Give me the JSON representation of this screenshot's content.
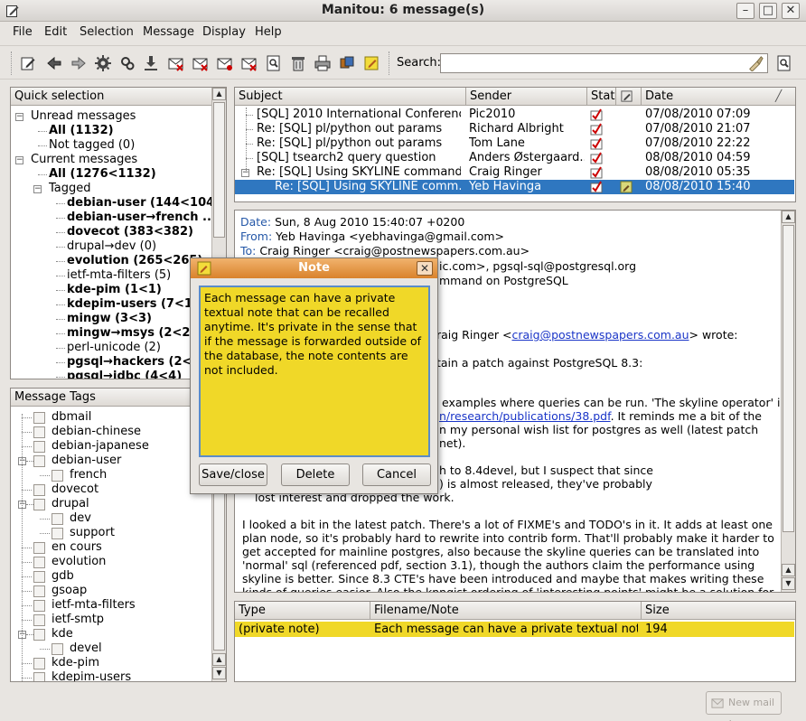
{
  "window": {
    "title": "Manitou: 6 message(s)",
    "min_glyph": "–",
    "max_glyph": "□",
    "close_glyph": "✕"
  },
  "menu": [
    "File",
    "Edit",
    "Selection",
    "Message",
    "Display",
    "Help"
  ],
  "toolbar": {
    "icons": [
      "compose-icon",
      "back-icon",
      "forward-icon",
      "settings-icon",
      "refresh-icon",
      "download-icon",
      "mark-read-icon",
      "mark-unread-icon",
      "mark-archived-icon",
      "mark-deleted-icon",
      "find-icon",
      "trash-icon",
      "print-icon",
      "tags-icon",
      "note-icon"
    ],
    "search_label": "Search:",
    "search_value": ""
  },
  "quick_selection": {
    "header": "Quick selection",
    "items": [
      {
        "label": "Unread messages",
        "bold": false,
        "level": 0,
        "expander": "-"
      },
      {
        "label": "All (1132)",
        "bold": true,
        "level": 1
      },
      {
        "label": "Not tagged (0)",
        "bold": false,
        "level": 1
      },
      {
        "label": "Current messages",
        "bold": false,
        "level": 0,
        "expander": "-"
      },
      {
        "label": "All (1276<1132)",
        "bold": true,
        "level": 1
      },
      {
        "label": "Tagged",
        "bold": false,
        "level": 1,
        "expander": "-"
      },
      {
        "label": "debian-user (144<104)",
        "bold": true,
        "level": 2
      },
      {
        "label": "debian-user→french ...",
        "bold": true,
        "level": 2
      },
      {
        "label": "dovecot (383<382)",
        "bold": true,
        "level": 2
      },
      {
        "label": "drupal→dev (0)",
        "bold": false,
        "level": 2
      },
      {
        "label": "evolution (265<265)",
        "bold": true,
        "level": 2
      },
      {
        "label": "ietf-mta-filters (5)",
        "bold": false,
        "level": 2
      },
      {
        "label": "kde-pim (1<1)",
        "bold": true,
        "level": 2
      },
      {
        "label": "kdepim-users (7<1)",
        "bold": true,
        "level": 2
      },
      {
        "label": "mingw (3<3)",
        "bold": true,
        "level": 2
      },
      {
        "label": "mingw→msys (2<2)",
        "bold": true,
        "level": 2
      },
      {
        "label": "perl-unicode (2)",
        "bold": false,
        "level": 2
      },
      {
        "label": "pgsql→hackers (2<2)",
        "bold": true,
        "level": 2
      },
      {
        "label": "pgsql→jdbc (4<4)",
        "bold": true,
        "level": 2
      }
    ]
  },
  "message_tags": {
    "header": "Message Tags",
    "items": [
      {
        "label": "dbmail",
        "level": 0
      },
      {
        "label": "debian-chinese",
        "level": 0
      },
      {
        "label": "debian-japanese",
        "level": 0
      },
      {
        "label": "debian-user",
        "level": 0,
        "expander": "-"
      },
      {
        "label": "french",
        "level": 1
      },
      {
        "label": "dovecot",
        "level": 0
      },
      {
        "label": "drupal",
        "level": 0,
        "expander": "-"
      },
      {
        "label": "dev",
        "level": 1
      },
      {
        "label": "support",
        "level": 1
      },
      {
        "label": "en cours",
        "level": 0
      },
      {
        "label": "evolution",
        "level": 0
      },
      {
        "label": "gdb",
        "level": 0
      },
      {
        "label": "gsoap",
        "level": 0
      },
      {
        "label": "ietf-mta-filters",
        "level": 0
      },
      {
        "label": "ietf-smtp",
        "level": 0
      },
      {
        "label": "kde",
        "level": 0,
        "expander": "-"
      },
      {
        "label": "devel",
        "level": 1
      },
      {
        "label": "kde-pim",
        "level": 0
      },
      {
        "label": "kdepim-users",
        "level": 0
      }
    ]
  },
  "message_list": {
    "columns": [
      "Subject",
      "Sender",
      "Stat",
      "",
      "Date"
    ],
    "rows": [
      {
        "subject": "[SQL] 2010 International Conferenc...",
        "sender": "Pic2010",
        "date": "07/08/2010 07:09",
        "indent": 0,
        "note": false,
        "selected": false
      },
      {
        "subject": "Re: [SQL] pl/python out params",
        "sender": "Richard Albright",
        "date": "07/08/2010 21:07",
        "indent": 0,
        "note": false,
        "selected": false
      },
      {
        "subject": "Re: [SQL] pl/python out params",
        "sender": "Tom Lane",
        "date": "07/08/2010 22:22",
        "indent": 0,
        "note": false,
        "selected": false
      },
      {
        "subject": "[SQL] tsearch2 query question",
        "sender": "Anders Østergaard...",
        "date": "08/08/2010 04:59",
        "indent": 0,
        "note": false,
        "selected": false
      },
      {
        "subject": "Re: [SQL] Using SKYLINE command...",
        "sender": "Craig Ringer",
        "date": "08/08/2010 05:35",
        "indent": 0,
        "note": false,
        "selected": false,
        "expander": "-"
      },
      {
        "subject": "Re: [SQL] Using SKYLINE comm...",
        "sender": "Yeb Havinga",
        "date": "08/08/2010 15:40",
        "indent": 1,
        "note": true,
        "selected": true
      }
    ]
  },
  "message_view": {
    "date_key": "Date:",
    "date_val": "Sun, 8 Aug 2010 15:40:07 +0200",
    "from_key": "From:",
    "from_val": "Yeb Havinga <yebhavinga@gmail.com>",
    "to_key": "To:",
    "to_val": "Craig Ringer <craig@postnewspapers.com.au>",
    "cc_tail": "ic.com>, pgsql-sql@postgresql.org",
    "subject_tail": "mmand on PostgreSQL",
    "wrote_pre": "raig Ringer <",
    "wrote_link": "craig@postnewspapers.com.au",
    "wrote_post": "> wrote:",
    "quote1": "tain a patch against PostgreSQL 8.3:",
    "para1_l1": "examples where queries can be run. 'The skyline operator' is",
    "para1_l2_link": "n/research/publications/38.pdf",
    "para1_l2_post": ". It reminds me a bit of the",
    "para1_l3": "n my personal wish list for postgres as well (latest patch",
    "para1_l4": "net).",
    "para2_l1": "h to 8.4devel, but I suspect that since",
    "para2_l2": ") is almost released, they've probably",
    "para2_l3": "lost interest and dropped the work.",
    "para3": [
      "I looked a bit in the latest patch. There's a lot of FIXME's and TODO's in it. It adds at least one",
      "plan node, so it's probably hard to rewrite into contrib form. That'll probably make it harder to",
      "get accepted for mainline postgres, also because the skyline queries can be translated into",
      "'normal' sql (referenced pdf, section 3.1), though the authors claim the performance using",
      "skyline is better. Since 8.3 CTE's have been introduced and maybe that makes writing these",
      "kinds of queries easier. Also the knngist ordering of 'interesting points' might be a solution for"
    ]
  },
  "attachments": {
    "columns": [
      "Type",
      "Filename/Note",
      "Size"
    ],
    "rows": [
      {
        "type": "(private note)",
        "name": "Each message can have a private textual note...",
        "size": "194"
      }
    ]
  },
  "note_dialog": {
    "title": "Note",
    "text": "Each message can have a private textual note that can be recalled anytime. It's private in the sense that if the message is forwarded outside of the database, the note contents are not included.",
    "buttons": [
      "Save/close",
      "Delete",
      "Cancel"
    ]
  },
  "status": {
    "new_mail_label": "New mail !"
  },
  "colors": {
    "selection": "#2f77c0",
    "note_yellow": "#f0d828",
    "dialog_title": "#d9822c",
    "header_key": "#2558a8"
  }
}
